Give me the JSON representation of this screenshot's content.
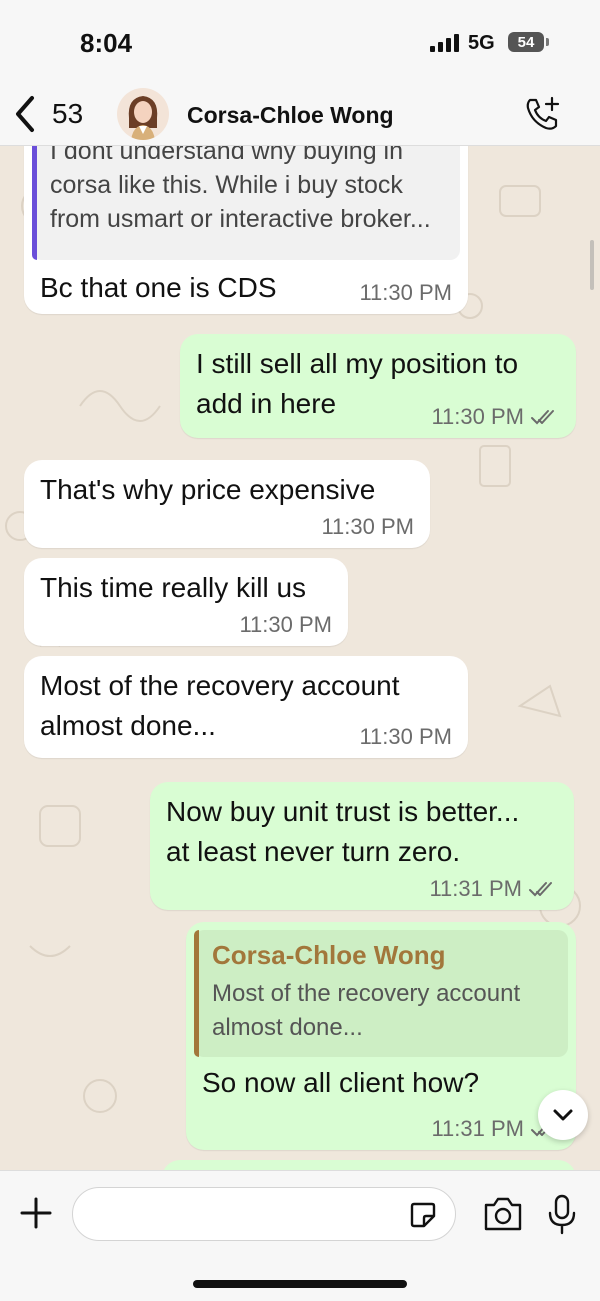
{
  "status": {
    "time": "8:04",
    "network": "5G",
    "battery": "54"
  },
  "header": {
    "back_count": "53",
    "contact_name": "Corsa-Chloe Wong"
  },
  "messages": {
    "m1": {
      "quote_line0": "I dont understand why buying in",
      "quote_line1": "corsa like this. While i buy stock",
      "quote_line2": "from usmart or interactive broker...",
      "text": "Bc that one is CDS",
      "time": "11:30 PM"
    },
    "m2": {
      "line1": "I still sell all my position to",
      "line2": "add in here",
      "time": "11:30 PM"
    },
    "m3": {
      "text": "That's why price expensive",
      "time": "11:30 PM"
    },
    "m4": {
      "text": "This time really kill us",
      "time": "11:30 PM"
    },
    "m5": {
      "line1": "Most of the recovery account",
      "line2": "almost done...",
      "time": "11:30 PM"
    },
    "m6": {
      "line1": "Now buy unit trust is better...",
      "line2": "at least never turn zero.",
      "time": "11:31 PM"
    },
    "m7": {
      "quote_author": "Corsa-Chloe Wong",
      "quote_line1": "Most of the recovery account",
      "quote_line2": "almost done...",
      "text": "So now all client how?",
      "time": "11:31 PM"
    }
  },
  "composer": {
    "placeholder": ""
  },
  "colors": {
    "incoming_bubble": "#ffffff",
    "outgoing_bubble": "#d9fdd3",
    "chat_background": "#efe7dc",
    "quote_bar_incoming": "#6a4ed9",
    "quote_bar_outgoing": "#a2773b"
  },
  "icons": [
    "back-chevron-icon",
    "add-call-icon",
    "plus-icon",
    "sticker-icon",
    "camera-icon",
    "mic-icon",
    "double-check-icon",
    "chevron-down-icon"
  ]
}
